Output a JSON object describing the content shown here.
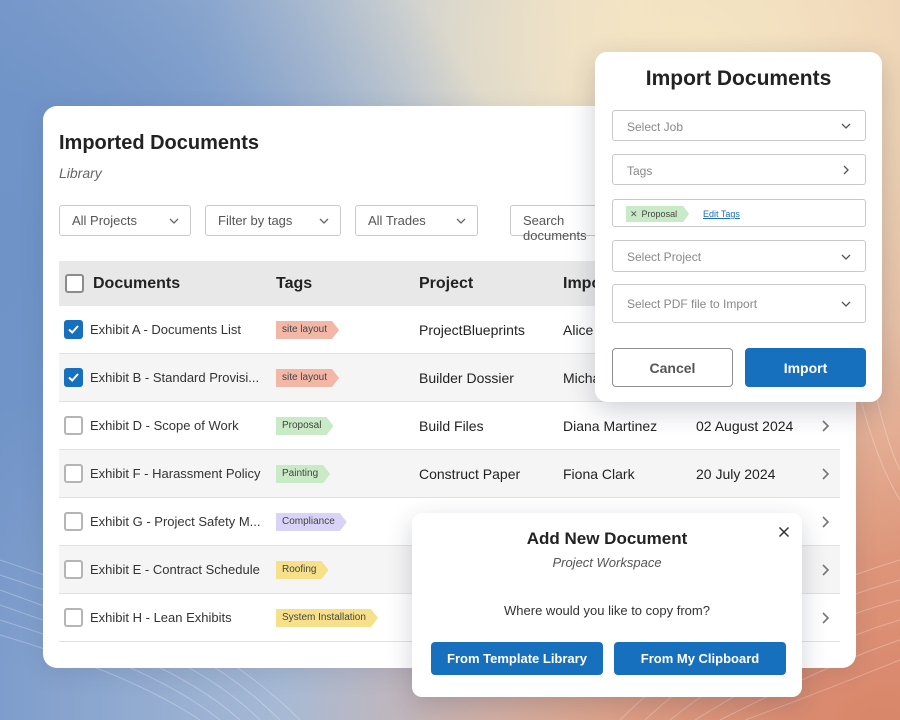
{
  "library": {
    "title": "Imported Documents",
    "subtitle": "Library",
    "filters": {
      "projects": "All Projects",
      "tags": "Filter by tags",
      "trades": "All Trades",
      "search_placeholder": "Search documents"
    },
    "columns": {
      "documents": "Documents",
      "tags": "Tags",
      "project": "Project",
      "imported_by": "Imported By"
    },
    "rows": [
      {
        "name": "Exhibit A - Documents List",
        "tag": "site layout",
        "tag_color": "#f3b7a8",
        "project": "ProjectBlueprints",
        "imported_by": "Alice Johnson",
        "date": "",
        "checked": true
      },
      {
        "name": "Exhibit B - Standard Provisi...",
        "tag": "site layout",
        "tag_color": "#f3b7a8",
        "project": "Builder  Dossier",
        "imported_by": "Michael Smith",
        "date": "",
        "checked": true
      },
      {
        "name": "Exhibit D - Scope of Work",
        "tag": "Proposal",
        "tag_color": "#c8eac6",
        "project": "Build Files",
        "imported_by": "Diana Martinez",
        "date": "02 August 2024",
        "checked": false
      },
      {
        "name": "Exhibit F - Harassment Policy",
        "tag": "Painting",
        "tag_color": "#c8eac6",
        "project": "Construct Paper",
        "imported_by": "Fiona Clark",
        "date": "20 July 2024",
        "checked": false
      },
      {
        "name": "Exhibit G - Project Safety M...",
        "tag": "Compliance",
        "tag_color": "#d9d3f7",
        "project": "",
        "imported_by": "",
        "date": "",
        "checked": false
      },
      {
        "name": "Exhibit E - Contract Schedule",
        "tag": "Roofing",
        "tag_color": "#f7e08a",
        "project": "",
        "imported_by": "",
        "date": "",
        "checked": false
      },
      {
        "name": "Exhibit H - Lean Exhibits",
        "tag": "System Installation",
        "tag_color": "#f7e08a",
        "project": "",
        "imported_by": "",
        "date": "",
        "checked": false
      }
    ]
  },
  "import_modal": {
    "title": "Import Documents",
    "select_job": "Select Job",
    "tags": "Tags",
    "chip_label": "Proposal",
    "edit_tags": "Edit Tags",
    "select_project": "Select Project",
    "select_pdf": "Select PDF file to Import",
    "cancel": "Cancel",
    "import": "Import"
  },
  "add_modal": {
    "title": "Add New Document",
    "subtitle": "Project Workspace",
    "question": "Where would you like to copy from?",
    "from_template": "From Template Library",
    "from_clipboard": "From My Clipboard"
  },
  "colors": {
    "primary": "#1670be",
    "header_bg": "#e8e8e8"
  }
}
